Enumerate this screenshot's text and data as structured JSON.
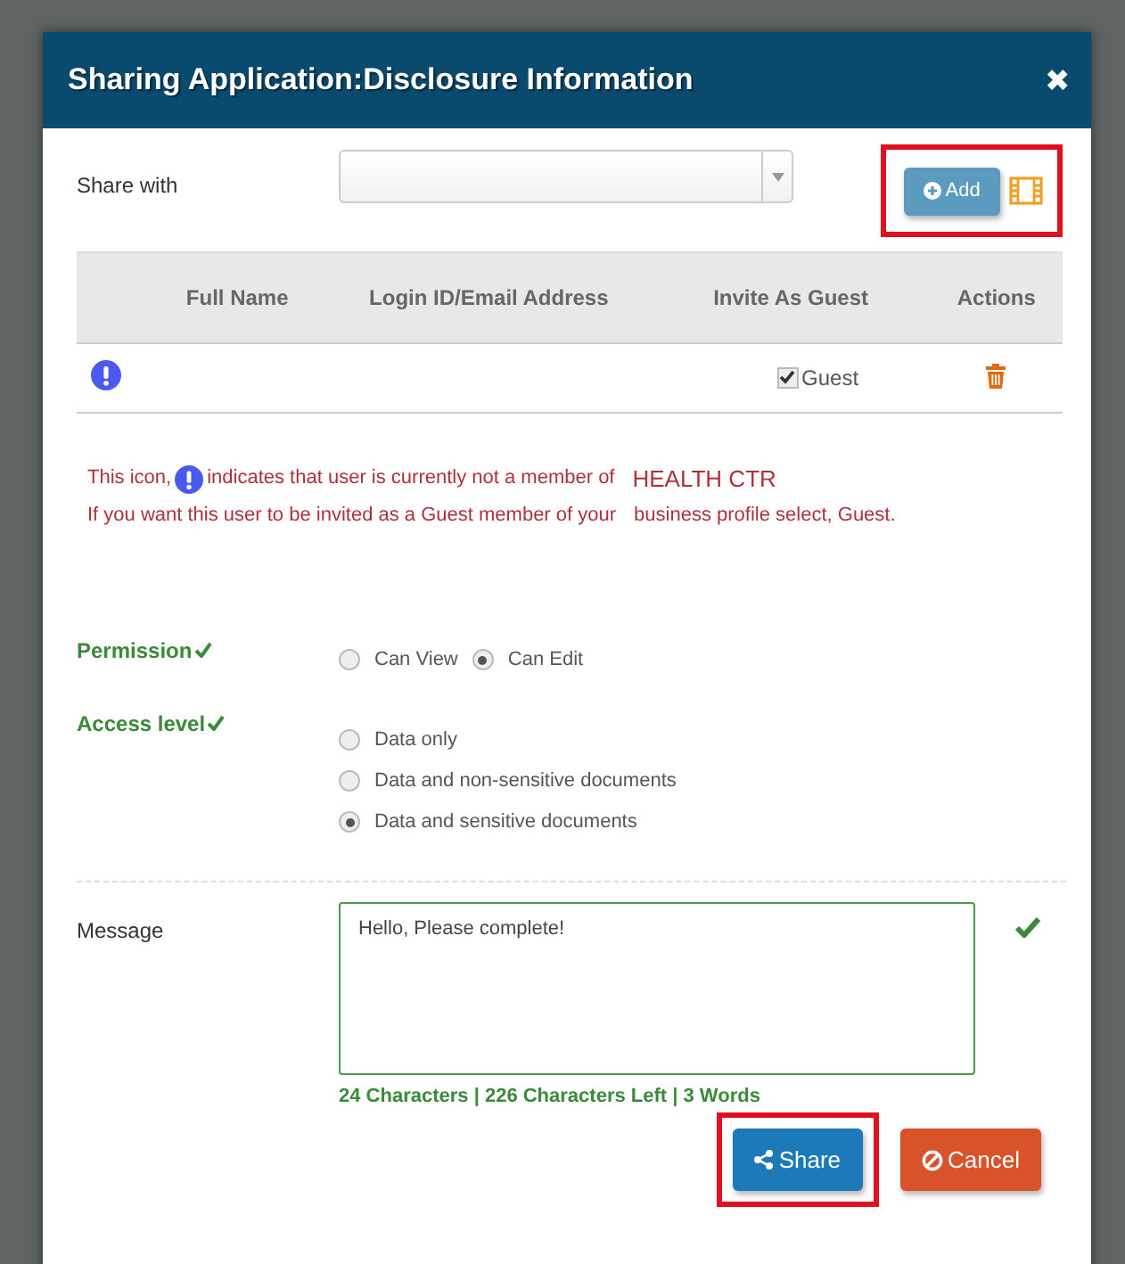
{
  "dialog": {
    "title": "Sharing Application:Disclosure Information",
    "close": "✖"
  },
  "share_with": {
    "label": "Share with",
    "add_button": {
      "label": "Add",
      "highlighted": true
    }
  },
  "table": {
    "columns": [
      "Full Name",
      "Login ID/Email Address",
      "Invite As Guest",
      "Actions"
    ],
    "rows": [
      {
        "not_member": true,
        "guest_label": "Guest",
        "guest_checked": true
      }
    ]
  },
  "notice": {
    "line1_before": "This icon,",
    "line1_after": "indicates that user is currently not a member of",
    "org": "HEALTH CTR",
    "line2a": "If you want this user to be invited as a Guest member of your",
    "line2b": "business profile select, Guest."
  },
  "permission": {
    "label": "Permission",
    "valid": true,
    "options": [
      {
        "label": "Can View",
        "selected": false
      },
      {
        "label": "Can Edit",
        "selected": true
      }
    ]
  },
  "access_level": {
    "label": "Access level",
    "valid": true,
    "options": [
      {
        "label": "Data only",
        "selected": false
      },
      {
        "label": "Data and non-sensitive documents",
        "selected": false
      },
      {
        "label": "Data and sensitive documents",
        "selected": true
      }
    ]
  },
  "message": {
    "label": "Message",
    "value": "Hello, Please complete!",
    "valid": true,
    "counter": "24 Characters | 226 Characters Left | 3 Words"
  },
  "buttons": [
    {
      "kind": "share",
      "label": "Share",
      "highlighted": true
    },
    {
      "kind": "cancel",
      "label": "Cancel",
      "highlighted": false
    }
  ]
}
